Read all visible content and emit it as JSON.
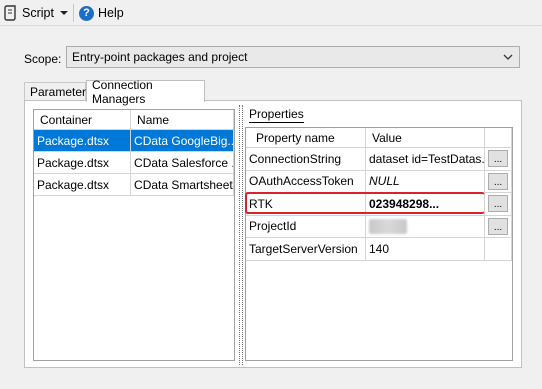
{
  "toolbar": {
    "script_label": "Script",
    "help_label": "Help"
  },
  "scope": {
    "label": "Scope:",
    "value": "Entry-point packages and project"
  },
  "tabs": [
    {
      "label": "Parameters",
      "active": false
    },
    {
      "label": "Connection Managers",
      "active": true
    }
  ],
  "connections": {
    "columns": [
      "Container",
      "Name"
    ],
    "rows": [
      {
        "container": "Package.dtsx",
        "name": "CData GoogleBig...",
        "selected": true
      },
      {
        "container": "Package.dtsx",
        "name": "CData Salesforce ...",
        "selected": false
      },
      {
        "container": "Package.dtsx",
        "name": "CData Smartsheet...",
        "selected": false
      }
    ]
  },
  "properties": {
    "label": "Properties",
    "columns": [
      "Property name",
      "Value"
    ],
    "rows": [
      {
        "name": "ConnectionString",
        "value": "dataset id=TestDatas...",
        "button": "..."
      },
      {
        "name": "OAuthAccessToken",
        "value": "NULL",
        "button": "..."
      },
      {
        "name": "RTK",
        "value": "023948298...",
        "button": "..."
      },
      {
        "name": "ProjectId",
        "value": "",
        "button": "..."
      },
      {
        "name": "TargetServerVersion",
        "value": "140",
        "button": ""
      }
    ]
  },
  "colors": {
    "selection": "#0078d7",
    "highlight": "#d8232a",
    "help_icon": "#1c6fc7"
  }
}
